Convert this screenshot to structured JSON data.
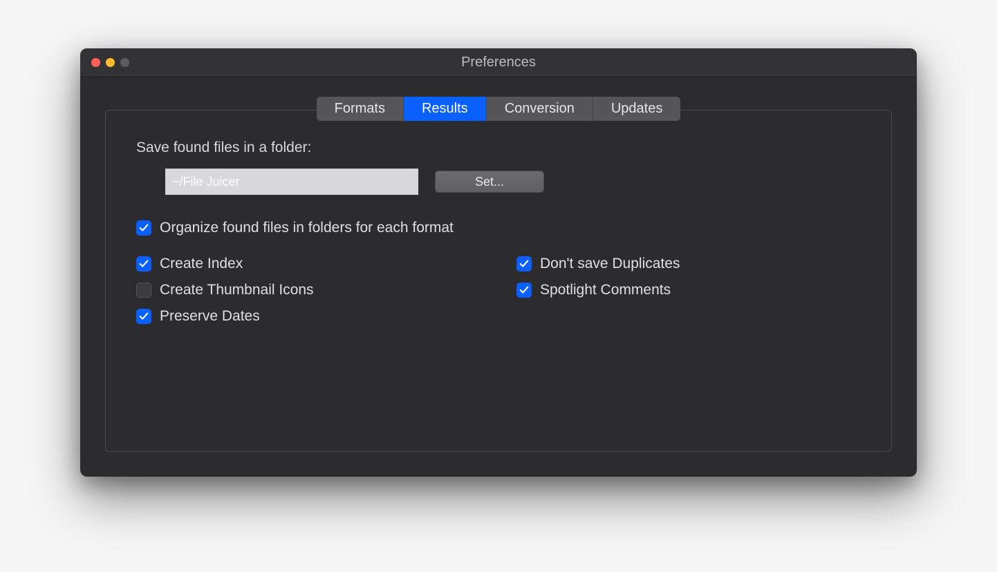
{
  "window": {
    "title": "Preferences"
  },
  "tabs": {
    "formats": "Formats",
    "results": "Results",
    "conversion": "Conversion",
    "updates": "Updates"
  },
  "results": {
    "save_label": "Save found files in a folder:",
    "path_value": "~/File Juicer",
    "set_button": "Set...",
    "organize_label": "Organize found files in folders for each format",
    "create_index_label": "Create Index",
    "create_thumb_label": "Create Thumbnail Icons",
    "preserve_dates_label": "Preserve Dates",
    "no_duplicates_label": "Don't save Duplicates",
    "spotlight_label": "Spotlight Comments",
    "checked": {
      "organize": true,
      "create_index": true,
      "create_thumb": false,
      "preserve_dates": true,
      "no_duplicates": true,
      "spotlight": true
    }
  }
}
